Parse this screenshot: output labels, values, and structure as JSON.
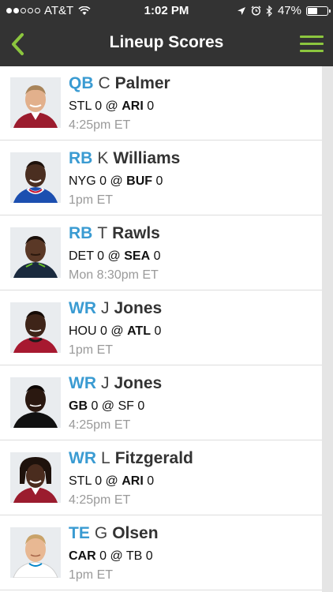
{
  "status_bar": {
    "carrier": "AT&T",
    "time": "1:02 PM",
    "battery": "47%",
    "battery_level": 0.47,
    "signal_bars_filled": 2,
    "signal_bars_total": 5
  },
  "nav": {
    "title": "Lineup Scores",
    "back_icon": "chevron-left-icon",
    "menu_icon": "hamburger-menu-icon",
    "accent_color": "#8cc63e"
  },
  "colors": {
    "bar_background": "#333333",
    "position_color": "#3a9bd2",
    "time_color": "#9a9a9a"
  },
  "players": [
    {
      "position": "QB",
      "initial": "C",
      "last_name": "Palmer",
      "away": "STL",
      "away_score": "0",
      "home": "ARI",
      "home_score": "0",
      "bold_team": "home",
      "time": "4:25pm ET"
    },
    {
      "position": "RB",
      "initial": "K",
      "last_name": "Williams",
      "away": "NYG",
      "away_score": "0",
      "home": "BUF",
      "home_score": "0",
      "bold_team": "home",
      "time": "1pm ET"
    },
    {
      "position": "RB",
      "initial": "T",
      "last_name": "Rawls",
      "away": "DET",
      "away_score": "0",
      "home": "SEA",
      "home_score": "0",
      "bold_team": "home",
      "time": "Mon 8:30pm ET"
    },
    {
      "position": "WR",
      "initial": "J",
      "last_name": "Jones",
      "away": "HOU",
      "away_score": "0",
      "home": "ATL",
      "home_score": "0",
      "bold_team": "home",
      "time": "1pm ET"
    },
    {
      "position": "WR",
      "initial": "J",
      "last_name": "Jones",
      "away": "GB",
      "away_score": "0",
      "home": "SF",
      "home_score": "0",
      "bold_team": "away",
      "time": "4:25pm ET"
    },
    {
      "position": "WR",
      "initial": "L",
      "last_name": "Fitzgerald",
      "away": "STL",
      "away_score": "0",
      "home": "ARI",
      "home_score": "0",
      "bold_team": "home",
      "time": "4:25pm ET"
    },
    {
      "position": "TE",
      "initial": "G",
      "last_name": "Olsen",
      "away": "CAR",
      "away_score": "0",
      "home": "TB",
      "home_score": "0",
      "bold_team": "away",
      "time": "1pm ET"
    }
  ]
}
